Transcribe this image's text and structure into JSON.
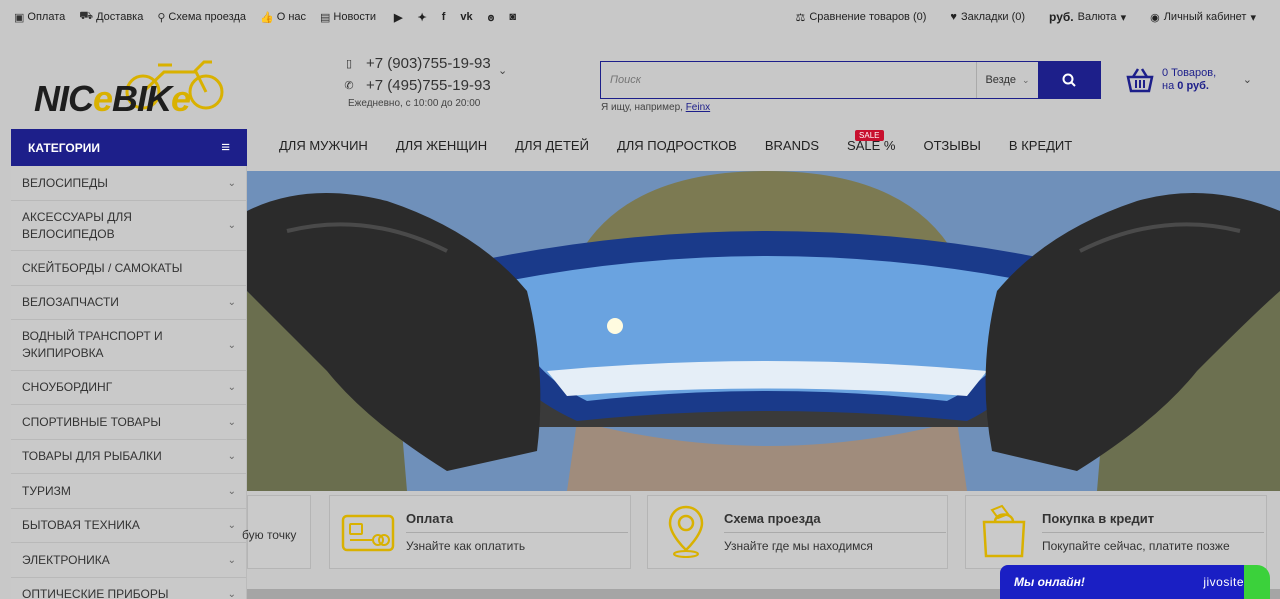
{
  "topbar": {
    "links": [
      {
        "icon": "payment-icon",
        "label": "Оплата"
      },
      {
        "icon": "truck-icon",
        "label": "Доставка"
      },
      {
        "icon": "map-pin-icon",
        "label": "Схема проезда"
      },
      {
        "icon": "thumbs-up-icon",
        "label": "О нас"
      },
      {
        "icon": "news-icon",
        "label": "Новости"
      }
    ],
    "social": [
      "youtube-icon",
      "twitter-icon",
      "facebook-icon",
      "vk-icon",
      "odnoklassniki-icon",
      "instagram-icon"
    ],
    "compare": "Сравнение товаров (0)",
    "bookmarks": "Закладки (0)",
    "currency": "руб.",
    "currency_label": "Валюта",
    "account": "Личный кабинет"
  },
  "header": {
    "logo": {
      "part1": "NIC",
      "part2": "e",
      "part3": "BIK",
      "part4": "e"
    },
    "phones": [
      "+7 (903)755-19-93",
      "+7 (495)755-19-93"
    ],
    "hours": "Ежедневно, с 10:00 до 20:00",
    "search": {
      "placeholder": "Поиск",
      "scope": "Везде",
      "hint_prefix": "Я ищу, например,",
      "hint_link": "Feinx"
    },
    "cart": {
      "line1": "0 Товаров,",
      "line2_prefix": "на",
      "line2_value": "0 руб."
    }
  },
  "categories": {
    "title": "КАТЕГОРИИ",
    "items": [
      "ВЕЛОСИПЕДЫ",
      "АКСЕССУАРЫ ДЛЯ ВЕЛОСИПЕДОВ",
      "СКЕЙТБОРДЫ / САМОКАТЫ",
      "ВЕЛОЗАПЧАСТИ",
      "ВОДНЫЙ ТРАНСПОРТ И ЭКИПИРОВКА",
      "СНОУБОРДИНГ",
      "СПОРТИВНЫЕ ТОВАРЫ",
      "ТОВАРЫ ДЛЯ РЫБАЛКИ",
      "ТУРИЗМ",
      "БЫТОВАЯ ТЕХНИКА",
      "ЭЛЕКТРОНИКА",
      "ОПТИЧЕСКИЕ ПРИБОРЫ"
    ]
  },
  "nav": {
    "items": [
      "ДЛЯ МУЖЧИН",
      "ДЛЯ ЖЕНЩИН",
      "ДЛЯ ДЕТЕЙ",
      "ДЛЯ ПОДРОСТКОВ",
      "BRANDS",
      "SALE %",
      "ОТЗЫВЫ",
      "В КРЕДИТ"
    ],
    "sale_badge": "SALE"
  },
  "info_boxes": [
    {
      "title": "",
      "text": "бую точку"
    },
    {
      "title": "Оплата",
      "text": "Узнайте как оплатить"
    },
    {
      "title": "Схема проезда",
      "text": "Узнайте где мы находимся"
    },
    {
      "title": "Покупка в кредит",
      "text": "Покупайте сейчас, платите позже"
    }
  ],
  "chat": {
    "message": "Мы онлайн!",
    "brand": "jivosite"
  },
  "colors": {
    "brand": "#1d1f8a",
    "accent": "#d9b100",
    "sale": "#c8102e",
    "chat": "#1a1fc4"
  }
}
